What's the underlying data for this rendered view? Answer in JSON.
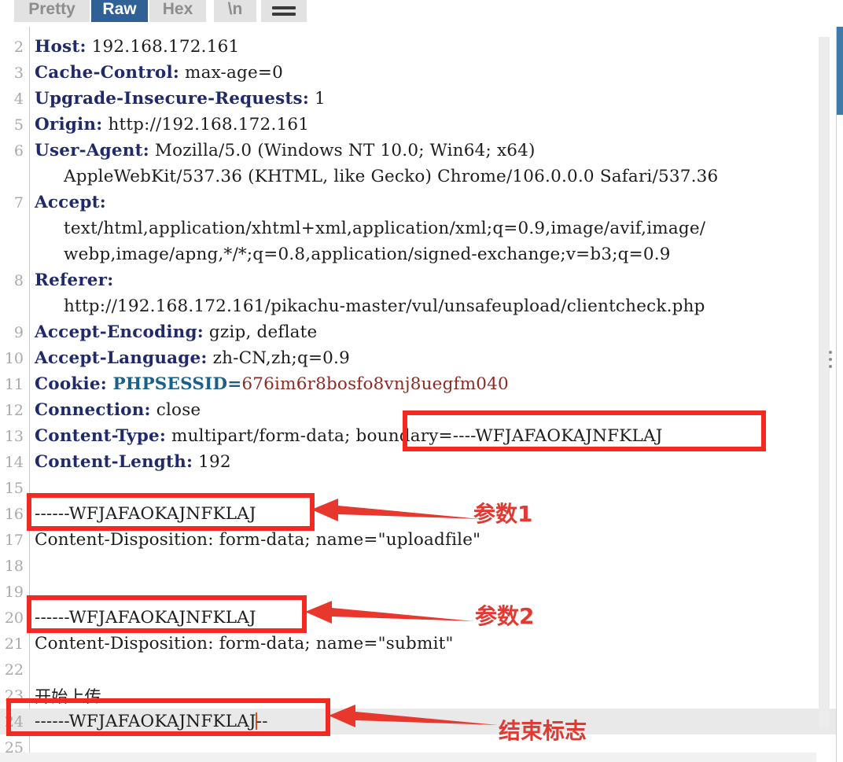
{
  "tabbar": {
    "tabs": [
      {
        "id": "pretty",
        "label": "Pretty",
        "active": false
      },
      {
        "id": "raw",
        "label": "Raw",
        "active": true
      },
      {
        "id": "hex",
        "label": "Hex",
        "active": false
      },
      {
        "id": "nl",
        "label": "\\n",
        "active": false
      }
    ],
    "menu_icon": "hamburger-menu-icon"
  },
  "editor": {
    "lines": [
      {
        "no": "2",
        "type": "header",
        "key": "Host:",
        "value": " 192.168.172.161"
      },
      {
        "no": "3",
        "type": "header",
        "key": "Cache-Control:",
        "value": " max-age=0"
      },
      {
        "no": "4",
        "type": "header",
        "key": "Upgrade-Insecure-Requests:",
        "value": " 1"
      },
      {
        "no": "5",
        "type": "header",
        "key": "Origin:",
        "value": " http://192.168.172.161"
      },
      {
        "no": "6",
        "type": "header",
        "key": "User-Agent:",
        "value": " Mozilla/5.0 (Windows NT 10.0; Win64; x64)"
      },
      {
        "no": "",
        "type": "cont",
        "value": "AppleWebKit/537.36 (KHTML, like Gecko) Chrome/106.0.0.0 Safari/537.36"
      },
      {
        "no": "7",
        "type": "header",
        "key": "Accept:",
        "value": ""
      },
      {
        "no": "",
        "type": "cont",
        "value": "text/html,application/xhtml+xml,application/xml;q=0.9,image/avif,image/"
      },
      {
        "no": "",
        "type": "cont",
        "value": "webp,image/apng,*/*;q=0.8,application/signed-exchange;v=b3;q=0.9"
      },
      {
        "no": "8",
        "type": "header",
        "key": "Referer:",
        "value": ""
      },
      {
        "no": "",
        "type": "cont",
        "value": "http://192.168.172.161/pikachu-master/vul/unsafeupload/clientcheck.php"
      },
      {
        "no": "9",
        "type": "header",
        "key": "Accept-Encoding:",
        "value": " gzip, deflate"
      },
      {
        "no": "10",
        "type": "header",
        "key": "Accept-Language:",
        "value": " zh-CN,zh;q=0.9"
      },
      {
        "no": "11",
        "type": "cookie",
        "key": "Cookie:",
        "cookie_name": " PHPSESSID=",
        "cookie_value": "676im6r8bosfo8vnj8uegfm040"
      },
      {
        "no": "12",
        "type": "header",
        "key": "Connection:",
        "value": " close"
      },
      {
        "no": "13",
        "type": "header",
        "key": "Content-Type:",
        "value": " multipart/form-data; boundary=----WFJAFAOKAJNFKLAJ"
      },
      {
        "no": "14",
        "type": "header",
        "key": "Content-Length:",
        "value": " 192"
      },
      {
        "no": "15",
        "type": "blank",
        "value": ""
      },
      {
        "no": "16",
        "type": "plain",
        "value": "------WFJAFAOKAJNFKLAJ"
      },
      {
        "no": "17",
        "type": "plain",
        "value": "Content-Disposition: form-data; name=\"uploadfile\""
      },
      {
        "no": "18",
        "type": "blank",
        "value": ""
      },
      {
        "no": "19",
        "type": "blank",
        "value": ""
      },
      {
        "no": "20",
        "type": "plain",
        "value": "------WFJAFAOKAJNFKLAJ"
      },
      {
        "no": "21",
        "type": "plain",
        "value": "Content-Disposition: form-data; name=\"submit\""
      },
      {
        "no": "22",
        "type": "blank",
        "value": ""
      },
      {
        "no": "23",
        "type": "cjk",
        "value": "开始上传"
      },
      {
        "no": "24",
        "type": "caret",
        "before": "------WFJAFAOKAJNFKLAJ",
        "after": "--"
      },
      {
        "no": "25",
        "type": "blank",
        "value": ""
      }
    ]
  },
  "annotations": [
    {
      "id": "boundary",
      "label": "",
      "box": true
    },
    {
      "id": "param1",
      "label": "参数1",
      "box": true
    },
    {
      "id": "param2",
      "label": "参数2",
      "box": true
    },
    {
      "id": "endmarker",
      "label": "结束标志",
      "box": true
    }
  ],
  "colors": {
    "accent_blue": "#2f6096",
    "annotation_red": "#f22a21",
    "annotation_text_red": "#e03a32",
    "header_navy": "#202a6b",
    "cookie_key_teal": "#1a5f8a",
    "cookie_value_maroon": "#8b2b24",
    "scrollbar_thumb": "#3f7aa8"
  }
}
